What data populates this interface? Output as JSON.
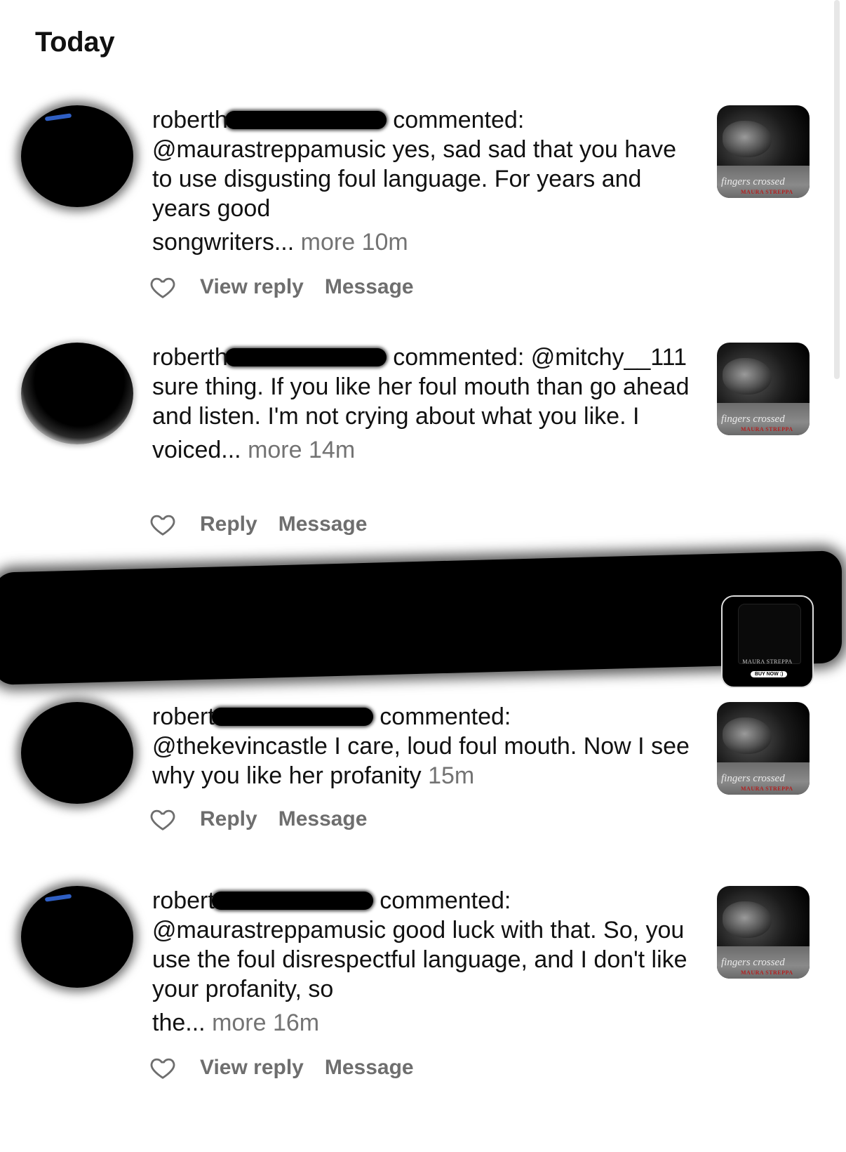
{
  "section": {
    "title": "Today"
  },
  "items": [
    {
      "username": "roberth",
      "action": "commented:",
      "text": "@maurastreppamusic yes, sad sad that you have to use disgusting foul language. For years and years good",
      "text_tail": "songwriters...",
      "more": "more",
      "time": "10m",
      "reply_label": "View reply",
      "message_label": "Message",
      "thumb_title": "fingers crossed",
      "thumb_artist": "MAURA STREPPA"
    },
    {
      "username": "roberth",
      "action": "commented:",
      "text": "@mitchy__111 sure thing. If you like her foul mouth than go ahead and listen. I'm not crying about what you like. I",
      "text_tail": "voiced...",
      "more": "more",
      "time": "14m",
      "reply_label": "Reply",
      "message_label": "Message",
      "thumb_title": "fingers crossed",
      "thumb_artist": "MAURA STREPPA"
    },
    {
      "username": "robert",
      "action": "commented:",
      "text": "@thekevincastle I care, loud foul mouth. Now I see why you like her profanity",
      "text_tail": "",
      "more": "",
      "time": "15m",
      "reply_label": "Reply",
      "message_label": "Message",
      "thumb_title": "fingers crossed",
      "thumb_artist": "MAURA STREPPA"
    },
    {
      "username": "robert",
      "action": "commented:",
      "text": "@maurastreppamusic good luck with that. So, you use the foul disrespectful language, and I don't like your profanity,  so",
      "text_tail": "the...",
      "more": "more",
      "time": "16m",
      "reply_label": "View reply",
      "message_label": "Message",
      "thumb_title": "fingers crossed",
      "thumb_artist": "MAURA STREPPA"
    }
  ],
  "redacted_item": {
    "thumb_artist": "MAURA STREPPA",
    "thumb_button": "BUY NOW :)"
  }
}
